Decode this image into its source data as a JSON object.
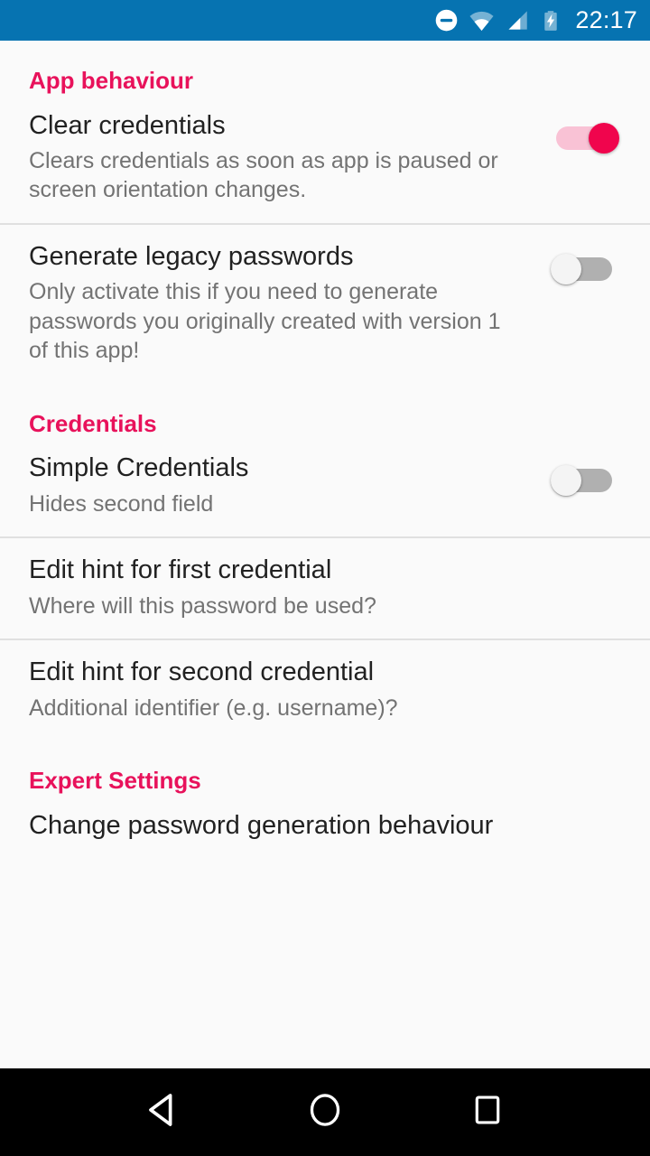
{
  "status_bar": {
    "background_color": "#0673b1",
    "time": "22:17",
    "icons": [
      "do-not-disturb-icon",
      "wifi-icon",
      "cellular-signal-icon",
      "battery-charging-icon"
    ]
  },
  "theme": {
    "accent_color": "#e8125b",
    "switch_on_thumb": "#f0054d",
    "switch_on_track": "#f9c2d5",
    "switch_off_track": "#b0b0b0",
    "switch_off_thumb": "#f4f4f4",
    "page_background": "#fafafa",
    "title_color": "#212121",
    "summary_color": "#737373"
  },
  "sections": [
    {
      "header": "App behaviour",
      "preferences": [
        {
          "title": "Clear credentials",
          "summary": "Clears credentials as soon as app is paused or screen orientation changes.",
          "control": "switch",
          "state": "on",
          "state_label": "ON"
        },
        {
          "title": "Generate legacy passwords",
          "summary": "Only activate this if you need to generate passwords you originally created with version 1 of this app!",
          "control": "switch",
          "state": "off",
          "state_label": "OFF"
        }
      ]
    },
    {
      "header": "Credentials",
      "preferences": [
        {
          "title": "Simple Credentials",
          "summary": "Hides second field",
          "control": "switch",
          "state": "off",
          "state_label": "OFF"
        },
        {
          "title": "Edit hint for first credential",
          "summary": "Where will this password be used?",
          "control": "none"
        },
        {
          "title": "Edit hint for second credential",
          "summary": "Additional identifier (e.g. username)?",
          "control": "none"
        }
      ]
    },
    {
      "header": "Expert Settings",
      "preferences": [
        {
          "title": "Change password generation behaviour",
          "summary": "",
          "control": "none"
        }
      ]
    }
  ],
  "nav_bar": {
    "background_color": "#000000",
    "buttons": [
      {
        "name": "back",
        "icon": "back-triangle-icon"
      },
      {
        "name": "home",
        "icon": "home-circle-icon"
      },
      {
        "name": "recents",
        "icon": "recents-square-icon"
      }
    ]
  }
}
